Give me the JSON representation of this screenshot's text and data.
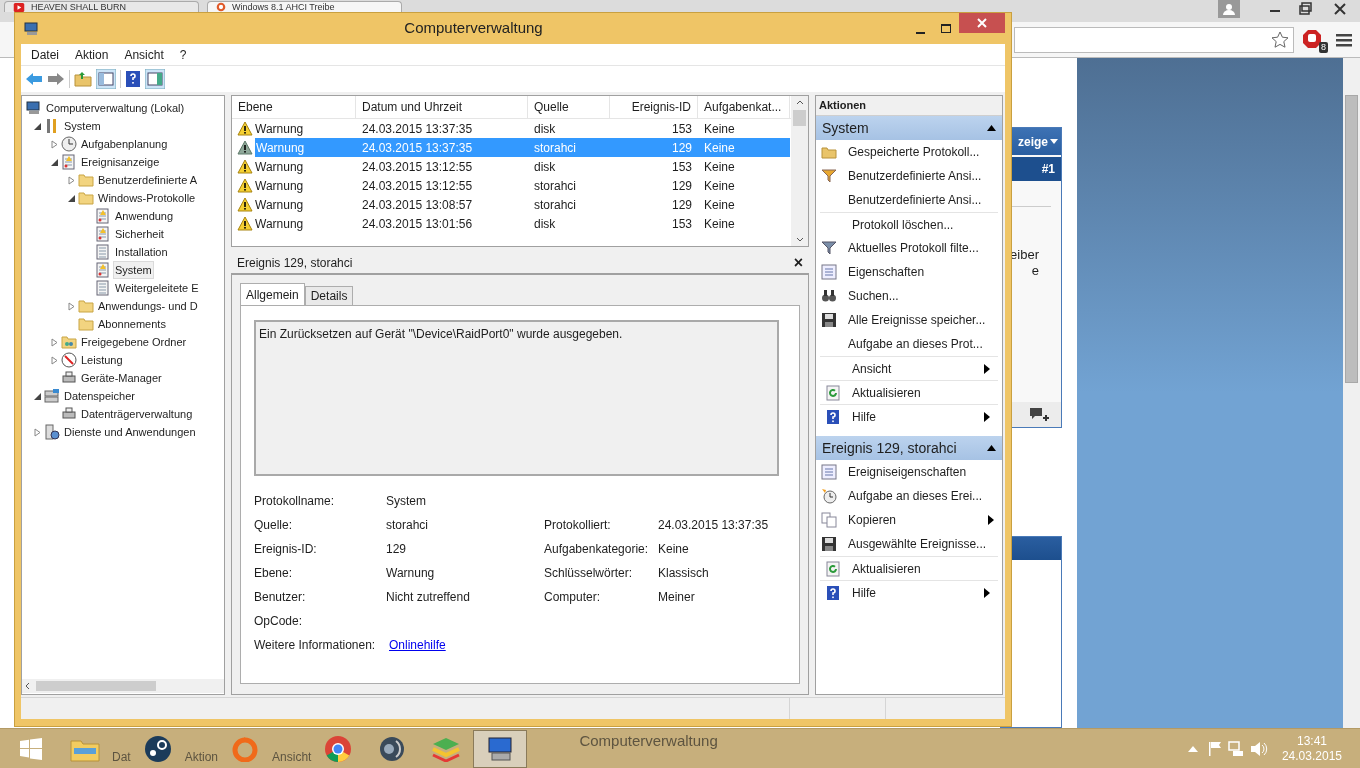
{
  "browser": {
    "tabs": [
      {
        "title": "HEAVEN SHALL BURN",
        "selected": false
      },
      {
        "title": "Windows 8.1 AHCI Treibe",
        "selected": true
      }
    ],
    "extension_badge": "8",
    "page": {
      "panel_header": "zeige",
      "panel_badge": "#1",
      "panel_lines": [
        "eiber",
        "e"
      ]
    }
  },
  "window": {
    "title": "Computerverwaltung",
    "menu": [
      "Datei",
      "Aktion",
      "Ansicht",
      "?"
    ],
    "tree": [
      {
        "label": "Computerverwaltung (Lokal)",
        "children": [
          {
            "label": "System",
            "expanded": true,
            "children": [
              {
                "label": "Aufgabenplanung",
                "expanded": false
              },
              {
                "label": "Ereignisanzeige",
                "expanded": true,
                "children": [
                  {
                    "label": "Benutzerdefinierte A",
                    "expanded": false
                  },
                  {
                    "label": "Windows-Protokolle",
                    "expanded": true,
                    "children": [
                      {
                        "label": "Anwendung",
                        "selected": false
                      },
                      {
                        "label": "Sicherheit",
                        "selected": false
                      },
                      {
                        "label": "Installation",
                        "selected": false
                      },
                      {
                        "label": "System",
                        "selected": true
                      },
                      {
                        "label": "Weitergeleitete E",
                        "selected": false
                      }
                    ]
                  },
                  {
                    "label": "Anwendungs- und D",
                    "expanded": false
                  },
                  {
                    "label": "Abonnements"
                  }
                ]
              },
              {
                "label": "Freigegebene Ordner",
                "expanded": false
              },
              {
                "label": "Leistung",
                "expanded": false
              },
              {
                "label": "Geräte-Manager"
              }
            ]
          },
          {
            "label": "Datenspeicher",
            "expanded": true,
            "children": [
              {
                "label": "Datenträgerverwaltung"
              }
            ]
          },
          {
            "label": "Dienste und Anwendungen",
            "expanded": false
          }
        ]
      }
    ],
    "events": {
      "columns": [
        "Ebene",
        "Datum und Uhrzeit",
        "Quelle",
        "Ereignis-ID",
        "Aufgabenkat..."
      ],
      "rows": [
        {
          "level": "Warnung",
          "date": "24.03.2015 13:37:35",
          "source": "disk",
          "id": "153",
          "category": "Keine",
          "selected": false
        },
        {
          "level": "Warnung",
          "date": "24.03.2015 13:37:35",
          "source": "storahci",
          "id": "129",
          "category": "Keine",
          "selected": true
        },
        {
          "level": "Warnung",
          "date": "24.03.2015 13:12:55",
          "source": "disk",
          "id": "153",
          "category": "Keine",
          "selected": false
        },
        {
          "level": "Warnung",
          "date": "24.03.2015 13:12:55",
          "source": "storahci",
          "id": "129",
          "category": "Keine",
          "selected": false
        },
        {
          "level": "Warnung",
          "date": "24.03.2015 13:08:57",
          "source": "storahci",
          "id": "129",
          "category": "Keine",
          "selected": false
        },
        {
          "level": "Warnung",
          "date": "24.03.2015 13:01:56",
          "source": "disk",
          "id": "153",
          "category": "Keine",
          "selected": false
        }
      ]
    },
    "detail": {
      "title": "Ereignis 129, storahci",
      "close": "×",
      "tabs": [
        {
          "label": "Allgemein",
          "selected": true
        },
        {
          "label": "Details",
          "selected": false
        }
      ],
      "message": "Ein Zurücksetzen auf Gerät \"\\Device\\RaidPort0\" wurde ausgegeben.",
      "rows": [
        {
          "label": "Protokollname:",
          "value": "System"
        },
        {
          "label": "Quelle:",
          "value": "storahci",
          "label_2": "Protokolliert:",
          "value_2": "24.03.2015 13:37:35"
        },
        {
          "label": "Ereignis-ID:",
          "value": "129",
          "label_2": "Aufgabenkategorie:",
          "value_2": "Keine"
        },
        {
          "label": "Ebene:",
          "value": "Warnung",
          "label_2": "Schlüsselwörter:",
          "value_2": "Klassisch"
        },
        {
          "label": "Benutzer:",
          "value": "Nicht zutreffend",
          "label_2": "Computer:",
          "value_2": "Meiner"
        },
        {
          "label": "OpCode:"
        }
      ],
      "more_info": {
        "label": "Weitere Informationen:",
        "link": "Onlinehilfe"
      }
    },
    "actions": {
      "title": "Aktionen",
      "sections": [
        {
          "title": "System",
          "items": [
            {
              "label": "Gespeicherte Protokoll...",
              "submenu": false
            },
            {
              "label": "Benutzerdefinierte Ansi...",
              "submenu": false
            },
            {
              "label": "Benutzerdefinierte Ansi...",
              "submenu": false
            },
            {
              "label": "Protokoll löschen...",
              "submenu": false
            },
            {
              "label": "Aktuelles Protokoll filte...",
              "submenu": false
            },
            {
              "label": "Eigenschaften",
              "submenu": false
            },
            {
              "label": "Suchen...",
              "submenu": false
            },
            {
              "label": "Alle Ereignisse speicher...",
              "submenu": false
            },
            {
              "label": "Aufgabe an dieses Prot...",
              "submenu": false
            },
            {
              "label": "Ansicht",
              "submenu": true
            },
            {
              "label": "Aktualisieren",
              "submenu": false
            },
            {
              "label": "Hilfe",
              "submenu": true
            }
          ]
        },
        {
          "title": "Ereignis 129, storahci",
          "items": [
            {
              "label": "Ereigniseigenschaften",
              "submenu": false
            },
            {
              "label": "Aufgabe an dieses Erei...",
              "submenu": false
            },
            {
              "label": "Kopieren",
              "submenu": true
            },
            {
              "label": "Ausgewählte Ereignisse...",
              "submenu": false
            },
            {
              "label": "Aktualisieren",
              "submenu": false
            },
            {
              "label": "Hilfe",
              "submenu": true
            }
          ]
        }
      ]
    }
  },
  "taskbar": {
    "ghost_menu": [
      "Dat",
      "Aktion",
      "Ansicht"
    ],
    "ghost_title": "Computerverwaltung",
    "time": "13:41",
    "date": "24.03.2015"
  }
}
